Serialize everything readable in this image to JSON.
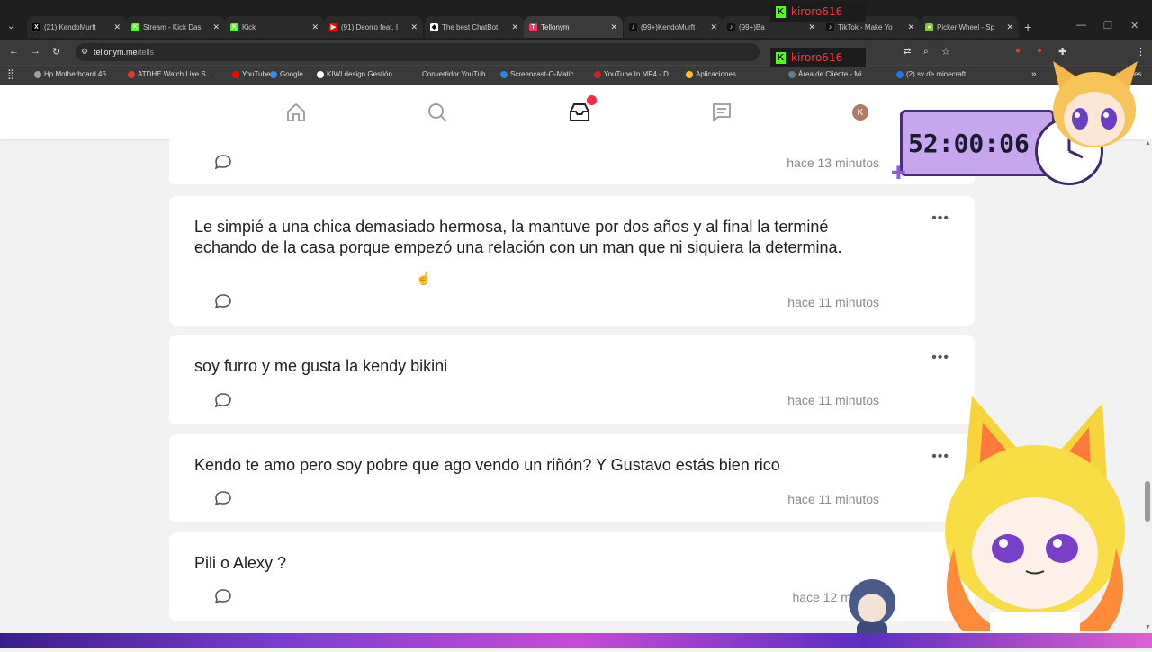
{
  "browser": {
    "tabs": [
      {
        "title": "(21) KendoMurft",
        "icon": "x-icon",
        "color": "#000000",
        "glyph": "X",
        "active": false
      },
      {
        "title": "Stream - Kick Das",
        "icon": "kick-icon",
        "color": "#53fc18",
        "glyph": "K",
        "active": false
      },
      {
        "title": "Kick",
        "icon": "kick-icon",
        "color": "#53fc18",
        "glyph": "K",
        "active": false
      },
      {
        "title": "(91) Deorro feat. I",
        "icon": "youtube-icon",
        "color": "#ff0000",
        "glyph": "▶",
        "active": false
      },
      {
        "title": "The best ChatBot",
        "icon": "chatbot-icon",
        "color": "#ffffff",
        "glyph": "◆",
        "active": false
      },
      {
        "title": "Tellonym",
        "icon": "tellonym-icon",
        "color": "#ff3366",
        "glyph": "T",
        "active": true
      },
      {
        "title": "(99+)KendoMurft",
        "icon": "tiktok-icon",
        "color": "#111111",
        "glyph": "♪",
        "active": false
      },
      {
        "title": "(99+)Ba",
        "icon": "tiktok-icon",
        "color": "#111111",
        "glyph": "♪",
        "active": false
      },
      {
        "title": "TikTok - Make Yo",
        "icon": "tiktok-icon",
        "color": "#111111",
        "glyph": "♪",
        "active": false
      },
      {
        "title": "Picker Wheel - Sp",
        "icon": "wheel-icon",
        "color": "#8bc34a",
        "glyph": "●",
        "active": false
      }
    ],
    "new_tab": "+",
    "url_host": "tellonym.me",
    "url_path": "/tells",
    "bookmarks": [
      {
        "label": "Hp Motherboard 46...",
        "color": "#9e9e9e"
      },
      {
        "label": "ATDHE Watch Live S...",
        "color": "#e53935"
      },
      {
        "label": "YouTube",
        "color": "#ff0000"
      },
      {
        "label": "Google",
        "color": "#4285f4"
      },
      {
        "label": "KIWI design Gestión...",
        "color": "#ffffff"
      },
      {
        "label": "Convertidor YouTub...",
        "color": "#3a3a3a"
      },
      {
        "label": "Screencast-O-Matic...",
        "color": "#1e88e5"
      },
      {
        "label": "YouTube In MP4 - D...",
        "color": "#c62828"
      },
      {
        "label": "Aplicaciones",
        "color": "#fbc02d"
      },
      {
        "label": "Área de Cliente - Mi...",
        "color": "#607d8b"
      },
      {
        "label": "(2) sv de minecraft...",
        "color": "#1877f2"
      }
    ],
    "bookmark_overflow": "»",
    "bookmark_tail": "cadores"
  },
  "app": {
    "nav": [
      {
        "name": "home-icon"
      },
      {
        "name": "search-icon"
      },
      {
        "name": "inbox-icon",
        "badge": true
      },
      {
        "name": "chat-icon"
      },
      {
        "name": "profile-avatar",
        "letter": "K"
      }
    ],
    "tells": [
      {
        "text": "",
        "time": "hace 13 minutos",
        "more": ""
      },
      {
        "text": "Le simpié a una chica demasiado hermosa, la mantuve por dos años y al final la terminé echando de la casa porque empezó una relación con un man que ni siquiera la determina.",
        "time": "hace 11 minutos",
        "more": "•••"
      },
      {
        "text": "soy furro y me gusta la kendy bikini",
        "time": "hace 11 minutos",
        "more": "•••"
      },
      {
        "text": "Kendo te amo pero soy pobre que ago vendo un riñón? Y Gustavo estás bien rico",
        "time": "hace 11 minutos",
        "more": "•••"
      },
      {
        "text": "Pili o Alexy ?",
        "time": "hace 12 mi",
        "more": ""
      }
    ]
  },
  "stream_overlay": {
    "timer": "52:00:06",
    "kick_users": [
      "kiroro616",
      "kiroro616"
    ]
  },
  "colors": {
    "accent": "#ff3344",
    "kick_green": "#53fc18",
    "timer_bg": "#c7a6ee"
  }
}
